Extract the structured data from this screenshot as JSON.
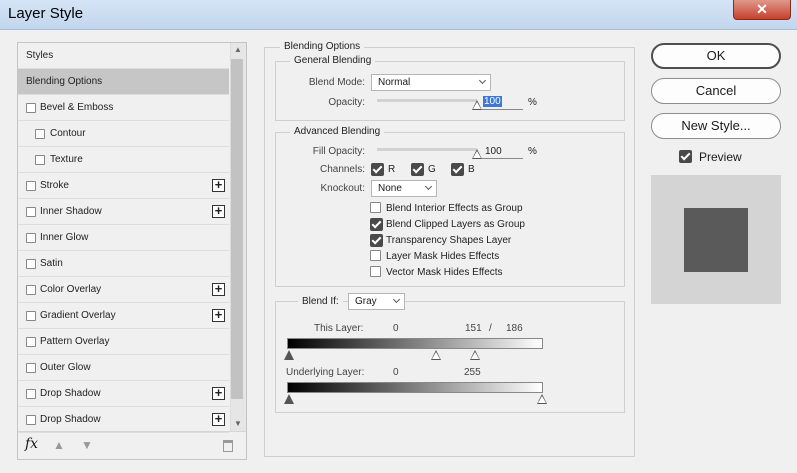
{
  "window": {
    "title": "Layer Style",
    "close_glyph": "✕"
  },
  "sidebar": {
    "items": [
      {
        "label": "Styles",
        "checkbox": false,
        "plus": false,
        "selected": false,
        "indent": false
      },
      {
        "label": "Blending Options",
        "checkbox": false,
        "plus": false,
        "selected": true,
        "indent": false
      },
      {
        "label": "Bevel & Emboss",
        "checkbox": true,
        "plus": false,
        "selected": false,
        "indent": false
      },
      {
        "label": "Contour",
        "checkbox": true,
        "plus": false,
        "selected": false,
        "indent": true
      },
      {
        "label": "Texture",
        "checkbox": true,
        "plus": false,
        "selected": false,
        "indent": true
      },
      {
        "label": "Stroke",
        "checkbox": true,
        "plus": true,
        "selected": false,
        "indent": false
      },
      {
        "label": "Inner Shadow",
        "checkbox": true,
        "plus": true,
        "selected": false,
        "indent": false
      },
      {
        "label": "Inner Glow",
        "checkbox": true,
        "plus": false,
        "selected": false,
        "indent": false
      },
      {
        "label": "Satin",
        "checkbox": true,
        "plus": false,
        "selected": false,
        "indent": false
      },
      {
        "label": "Color Overlay",
        "checkbox": true,
        "plus": true,
        "selected": false,
        "indent": false
      },
      {
        "label": "Gradient Overlay",
        "checkbox": true,
        "plus": true,
        "selected": false,
        "indent": false
      },
      {
        "label": "Pattern Overlay",
        "checkbox": true,
        "plus": false,
        "selected": false,
        "indent": false
      },
      {
        "label": "Outer Glow",
        "checkbox": true,
        "plus": false,
        "selected": false,
        "indent": false
      },
      {
        "label": "Drop Shadow",
        "checkbox": true,
        "plus": true,
        "selected": false,
        "indent": false
      },
      {
        "label": "Drop Shadow",
        "checkbox": true,
        "plus": true,
        "selected": false,
        "indent": false
      }
    ],
    "footer": {
      "fx_label": "fx",
      "up_icon": "arrow-up-icon",
      "down_icon": "arrow-down-icon",
      "delete_icon": "trash-icon"
    }
  },
  "blending_options": {
    "title": "Blending Options",
    "general": {
      "title": "General Blending",
      "blend_mode_label": "Blend Mode:",
      "blend_mode_value": "Normal",
      "opacity_label": "Opacity:",
      "opacity_value": "100",
      "opacity_unit": "%",
      "opacity_level": 1.0
    },
    "advanced": {
      "title": "Advanced Blending",
      "fill_opacity_label": "Fill Opacity:",
      "fill_opacity_value": "100",
      "fill_opacity_unit": "%",
      "fill_opacity_level": 1.0,
      "channels_label": "Channels:",
      "channels": [
        {
          "label": "R",
          "checked": true
        },
        {
          "label": "G",
          "checked": true
        },
        {
          "label": "B",
          "checked": true
        }
      ],
      "knockout_label": "Knockout:",
      "knockout_value": "None",
      "options": [
        {
          "label": "Blend Interior Effects as Group",
          "checked": false
        },
        {
          "label": "Blend Clipped Layers as Group",
          "checked": true
        },
        {
          "label": "Transparency Shapes Layer",
          "checked": true
        },
        {
          "label": "Layer Mask Hides Effects",
          "checked": false
        },
        {
          "label": "Vector Mask Hides Effects",
          "checked": false
        }
      ]
    },
    "blend_if": {
      "label": "Blend If:",
      "value": "Gray",
      "this_layer": {
        "label": "This Layer:",
        "low": "0",
        "high_a": "151",
        "sep": "/",
        "high_b": "186"
      },
      "underlying_layer": {
        "label": "Underlying Layer:",
        "low": "0",
        "high": "255"
      }
    }
  },
  "buttons": {
    "ok": "OK",
    "cancel": "Cancel",
    "new_style": "New Style..."
  },
  "preview": {
    "label": "Preview",
    "checked": true,
    "swatch_color": "#5a5a5a"
  }
}
